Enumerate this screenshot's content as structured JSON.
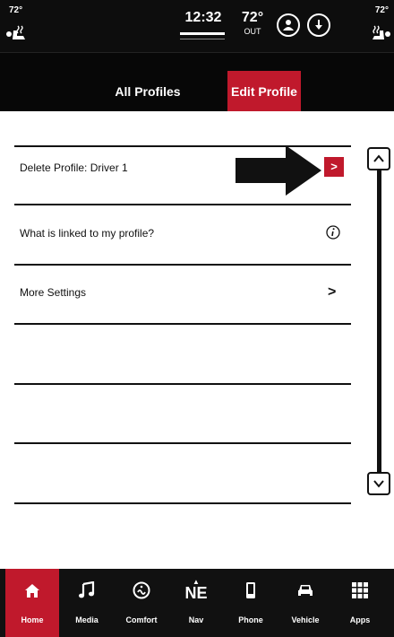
{
  "status_bar": {
    "left_temp": "72°",
    "right_temp": "72°",
    "clock": "12:32",
    "outside_temp": "72°",
    "outside_label": "OUT",
    "icons": [
      "driver-seat-heat-icon",
      "profile-icon",
      "download-icon",
      "passenger-seat-heat-icon"
    ]
  },
  "tabs": [
    {
      "label": "All Profiles",
      "active": false
    },
    {
      "label": "Edit Profile",
      "active": true
    }
  ],
  "list": {
    "rows": [
      {
        "label": "Delete Profile: Driver 1",
        "trailing": ">",
        "icon": "chevron-right-icon"
      },
      {
        "label": "What is linked to my profile?",
        "trailing": "",
        "icon": "info-icon"
      },
      {
        "label": "More Settings",
        "trailing": ">",
        "icon": "chevron-right-icon"
      }
    ]
  },
  "bottom_nav": {
    "items": [
      {
        "label": "Home",
        "icon": "home-icon",
        "active": true
      },
      {
        "label": "Media",
        "icon": "music-note-icon",
        "active": false
      },
      {
        "label": "Comfort",
        "icon": "comfort-icon",
        "active": false
      },
      {
        "label": "Nav",
        "icon": "compass-icon",
        "heading": "NE",
        "active": false
      },
      {
        "label": "Phone",
        "icon": "phone-icon",
        "active": false
      },
      {
        "label": "Vehicle",
        "icon": "car-icon",
        "active": false
      },
      {
        "label": "Apps",
        "icon": "apps-grid-icon",
        "active": false
      }
    ]
  },
  "colors": {
    "accent": "#c0192c",
    "bar_background": "#0d0d0d",
    "content_background": "#ffffff"
  }
}
